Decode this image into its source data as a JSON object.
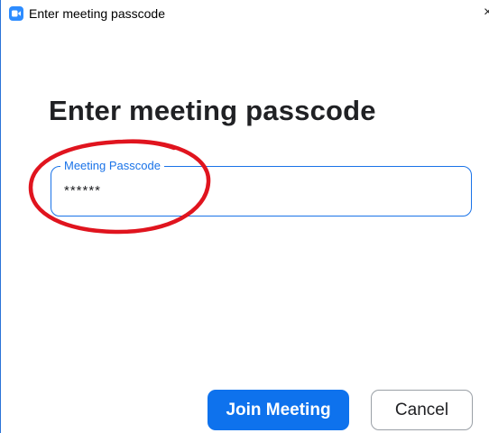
{
  "window": {
    "title": "Enter meeting passcode",
    "close_glyph": "×",
    "app_icon": "zoom-video-icon",
    "border_color": "#2b74d8"
  },
  "main": {
    "heading": "Enter meeting passcode",
    "passcode_field": {
      "label": "Meeting Passcode",
      "value": "******",
      "accent_color": "#1a73e8"
    },
    "annotation": {
      "shape": "ellipse",
      "color": "#e0141e"
    }
  },
  "actions": {
    "join_label": "Join Meeting",
    "join_color": "#0e72ed",
    "cancel_label": "Cancel"
  }
}
